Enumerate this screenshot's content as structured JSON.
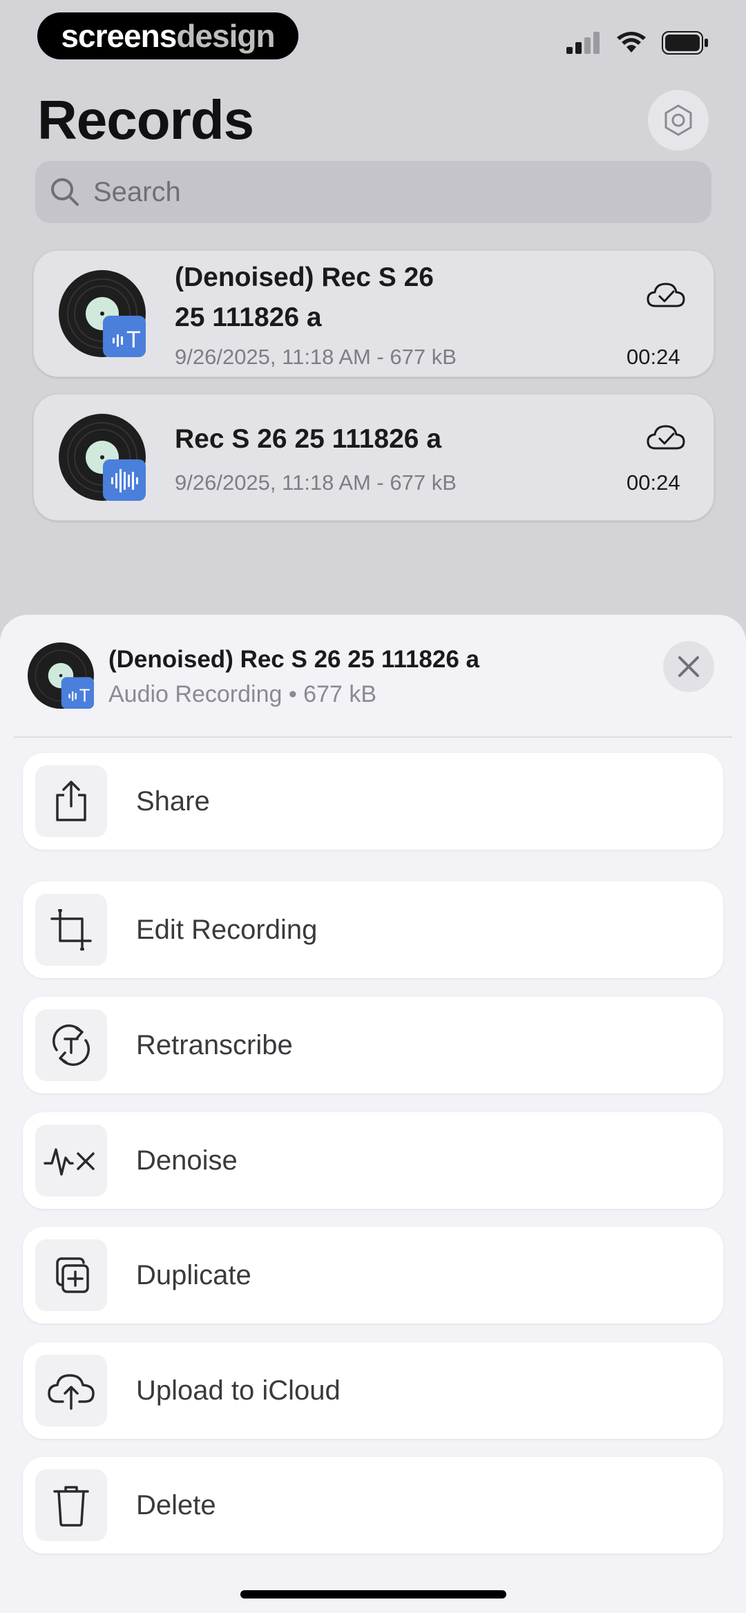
{
  "brand": {
    "part1": "screens",
    "part2": "design"
  },
  "header": {
    "title": "Records"
  },
  "search": {
    "placeholder": "Search"
  },
  "records": [
    {
      "title_line1": "(Denoised) Rec S 26",
      "title_line2": "25 111826 a",
      "meta": "9/26/2025, 11:18 AM - 677 kB",
      "duration": "00:24",
      "badge_icon": "transcript-icon"
    },
    {
      "title": "Rec S 26 25 111826 a",
      "meta": "9/26/2025, 11:18 AM - 677 kB",
      "duration": "00:24",
      "badge_icon": "waveform-icon"
    }
  ],
  "sheet": {
    "title": "(Denoised) Rec S 26 25 111826 a",
    "subtitle": "Audio Recording • 677 kB",
    "actions": [
      {
        "label": "Share",
        "icon": "share-icon"
      },
      {
        "label": "Edit Recording",
        "icon": "crop-icon"
      },
      {
        "label": "Retranscribe",
        "icon": "retranscribe-icon"
      },
      {
        "label": "Denoise",
        "icon": "denoise-icon"
      },
      {
        "label": "Duplicate",
        "icon": "duplicate-icon"
      },
      {
        "label": "Upload to iCloud",
        "icon": "cloud-upload-icon"
      },
      {
        "label": "Delete",
        "icon": "trash-icon"
      }
    ]
  },
  "colors": {
    "badge": "#4a7fdc",
    "sheet_bg": "#f2f2f7",
    "backdrop": "#d3d3d8"
  }
}
